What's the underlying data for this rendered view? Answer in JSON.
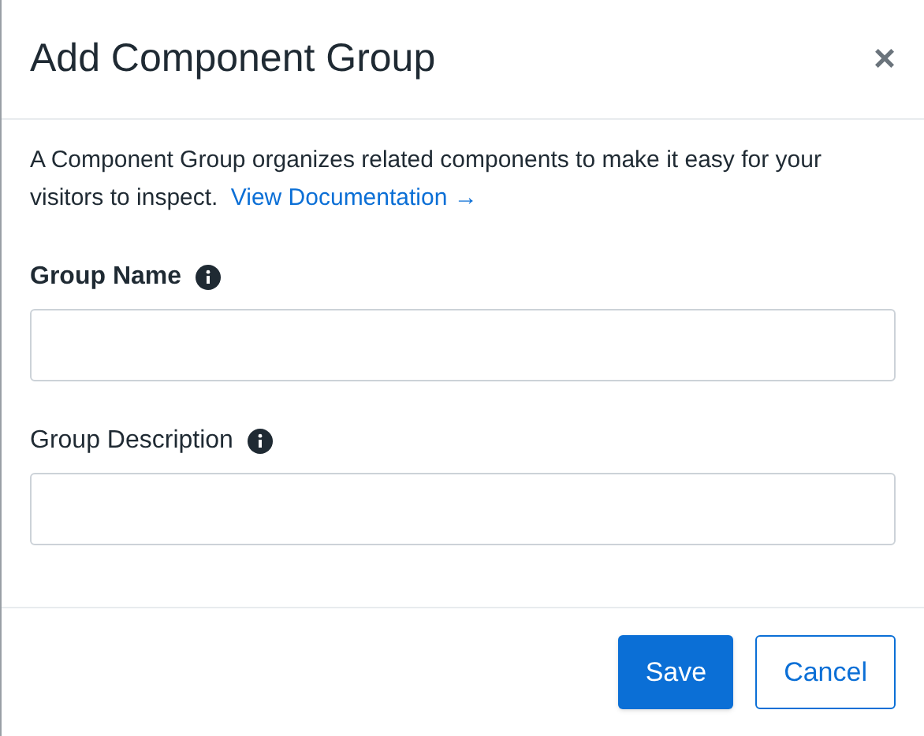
{
  "dialog": {
    "title": "Add Component Group",
    "close": "×"
  },
  "intro": {
    "text": "A Component Group organizes related components to make it easy for your visitors to inspect.",
    "link": "View Documentation →"
  },
  "fields": [
    {
      "label": "Group Name",
      "bold": true
    },
    {
      "label": "Group Description",
      "bold": false
    }
  ],
  "buttons": [
    {
      "label": "Save",
      "kind": "primary"
    },
    {
      "label": "Cancel",
      "kind": "secondary"
    }
  ]
}
